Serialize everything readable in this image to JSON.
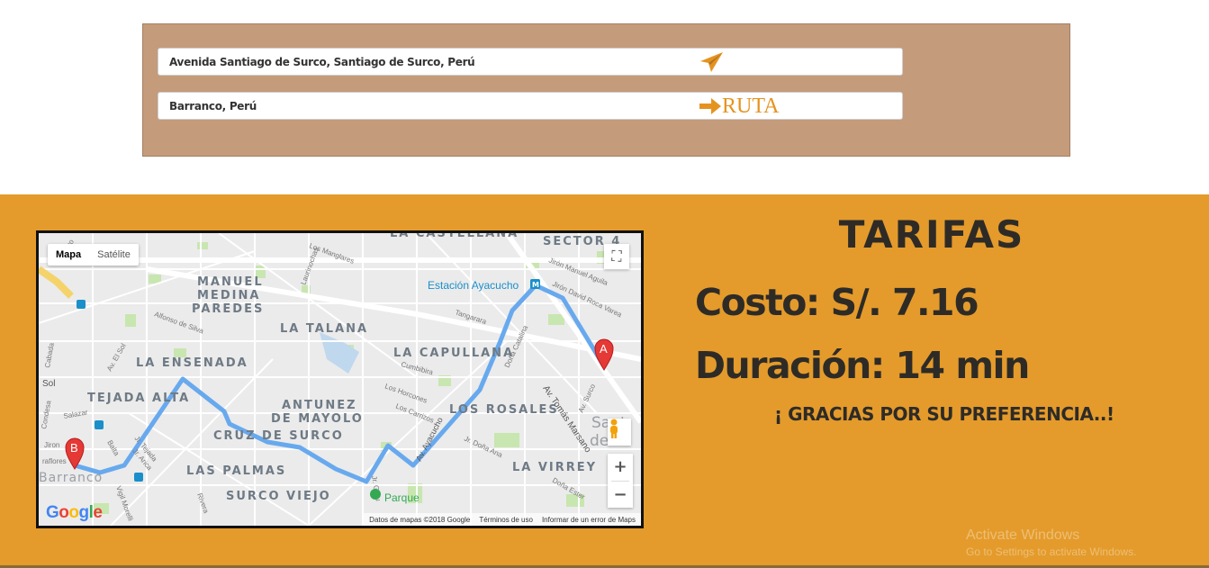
{
  "route_form": {
    "origin_value": "Avenida Santiago de Surco, Santiago de Surco, Perú",
    "destination_value": "Barranco, Perú",
    "route_button_label": "RUTA"
  },
  "map": {
    "type_options": [
      "Mapa",
      "Satélite"
    ],
    "selected_type": "Mapa",
    "marker_a": "A",
    "marker_b": "B",
    "zoom_in": "+",
    "zoom_out": "−",
    "labels": {
      "castellana": "LA CASTELLANA",
      "sector4": "SECTOR 4",
      "manuel_medina": "MANUEL",
      "medina": "MEDINA",
      "paredes": "PAREDES",
      "la_talana": "LA TALANA",
      "estacion": "Estación Ayacucho",
      "capullana": "LA CAPULLANA",
      "ensenada": "LA ENSENADA",
      "tejada_alta": "TEJADA ALTA",
      "antunez": "ANTUNEZ",
      "de_mayolo": "DE MAYOLO",
      "cruz_surco": "CRUZ DE SURCO",
      "los_rosales": "LOS ROSALES",
      "las_palmas": "LAS PALMAS",
      "la_virrey": "LA VIRREY",
      "surco_viejo": "SURCO VIEJO",
      "parque": "Parque",
      "barranco": "Barranco",
      "av_tomas_marsano": "Av. Tomás Marsano",
      "av_ayacucho": "Av. Ayacucho",
      "manglares": "Los Manglares",
      "laurinochas": "Laurinochas",
      "manuel_aguila": "Jirón Manuel Aguila",
      "david_roca": "Jirón David Roca Varea",
      "tangarara": "Tangarara",
      "cumbibira": "Cumbibira",
      "los_horcones": "Los Horcones",
      "los_carrizos": "Los Carrizos",
      "dona_catalina": "Doña Catalina",
      "dona_ana": "Jr. Doña Ana",
      "dona_ester": "Doña Ester",
      "av_surco": "Av. Surco",
      "alfonso_silva": "Alfonso de Silva",
      "av_el_sol": "Av. El Sol",
      "jr_tejada": "Jr. Tejada",
      "jr_arica": "Jr. Arica",
      "vigil_morelli": "Vigil Morelli",
      "jr_grau": "Jr. Grau",
      "rivera": "Rivera",
      "santiago": "Sant",
      "de_s": "de S",
      "sol": "Sol",
      "jiron": "Jiron",
      "salazar": "Salazar",
      "condesa": "Condesa",
      "cabada": "Cabada",
      "parpano": "Parpano",
      "raflores": "raflores",
      "balta": "Balta"
    },
    "google_logo": "Google",
    "footer": {
      "data": "Datos de mapas ©2018 Google",
      "terms": "Términos de uso",
      "report": "Informar de un error de Maps"
    }
  },
  "fares": {
    "title": "TARIFAS",
    "cost": "Costo: S/. 7.16",
    "duration": "Duración: 14 min",
    "thanks": "¡ GRACIAS POR SU PREFERENCIA..!"
  },
  "watermark": {
    "line1": "Activate Windows",
    "line2": "Go to Settings to activate Windows."
  },
  "colors": {
    "panel": "#c49b7b",
    "section": "#e49b2b",
    "accent": "#e59320",
    "route": "#6aaef0",
    "text_dark": "#2e2b27"
  }
}
